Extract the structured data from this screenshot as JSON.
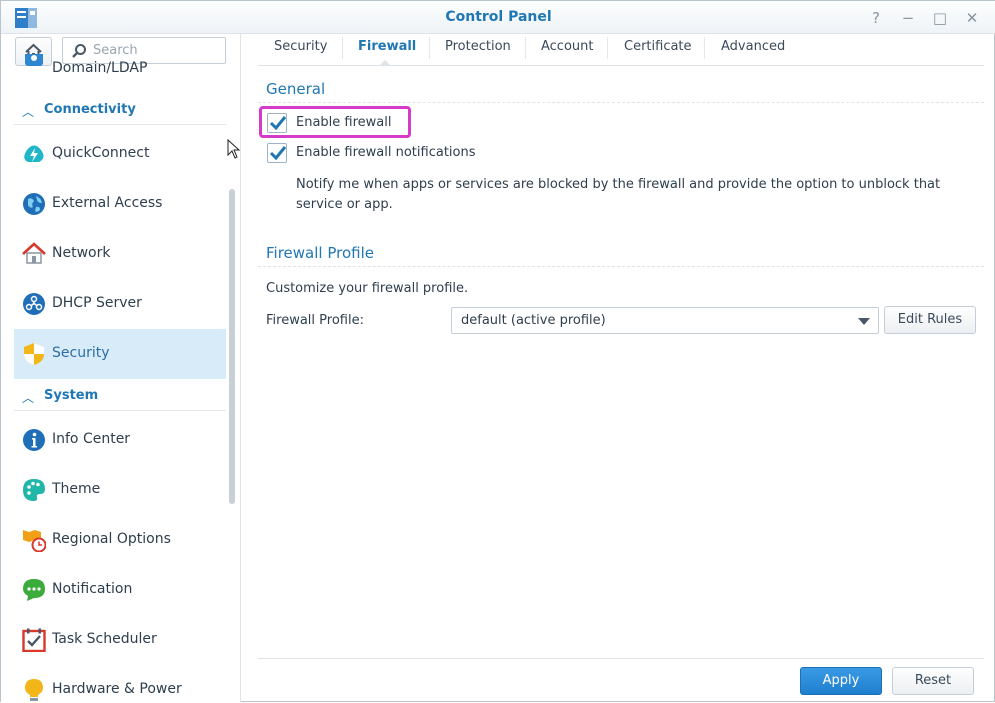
{
  "window": {
    "title": "Control Panel",
    "controls": {
      "help": "?",
      "minimize": "−",
      "maximize": "□",
      "close": "✕"
    }
  },
  "sidebar": {
    "search_placeholder": "Search",
    "partial_item": "Domain/LDAP",
    "groups": [
      {
        "label": "Connectivity"
      },
      {
        "label": "System"
      }
    ],
    "items": [
      {
        "label": "QuickConnect",
        "icon": "quickconnect-icon"
      },
      {
        "label": "External Access",
        "icon": "globe-icon"
      },
      {
        "label": "Network",
        "icon": "house-network-icon"
      },
      {
        "label": "DHCP Server",
        "icon": "dhcp-icon"
      },
      {
        "label": "Security",
        "icon": "shield-icon",
        "selected": true
      },
      {
        "label": "Info Center",
        "icon": "info-icon"
      },
      {
        "label": "Theme",
        "icon": "palette-icon"
      },
      {
        "label": "Regional Options",
        "icon": "clock-map-icon"
      },
      {
        "label": "Notification",
        "icon": "chat-icon"
      },
      {
        "label": "Task Scheduler",
        "icon": "calendar-icon"
      },
      {
        "label": "Hardware & Power",
        "icon": "bulb-icon"
      }
    ]
  },
  "tabs": [
    {
      "label": "Security"
    },
    {
      "label": "Firewall",
      "active": true
    },
    {
      "label": "Protection"
    },
    {
      "label": "Account"
    },
    {
      "label": "Certificate"
    },
    {
      "label": "Advanced"
    }
  ],
  "general": {
    "title": "General",
    "enable_firewall": {
      "label": "Enable firewall",
      "checked": true
    },
    "enable_notifications": {
      "label": "Enable firewall notifications",
      "checked": true
    },
    "description": "Notify me when apps or services are blocked by the firewall and provide the option to unblock that service or app."
  },
  "profile": {
    "title": "Firewall Profile",
    "customize_text": "Customize your firewall profile.",
    "field_label": "Firewall Profile:",
    "selected_value": "default (active profile)",
    "edit_rules_label": "Edit Rules"
  },
  "footer": {
    "apply_label": "Apply",
    "reset_label": "Reset"
  },
  "colors": {
    "accent": "#1f77b4",
    "selected_bg": "#d8ebf8",
    "highlight": "#d63ac8",
    "primary_button": "#2a8ad8"
  }
}
